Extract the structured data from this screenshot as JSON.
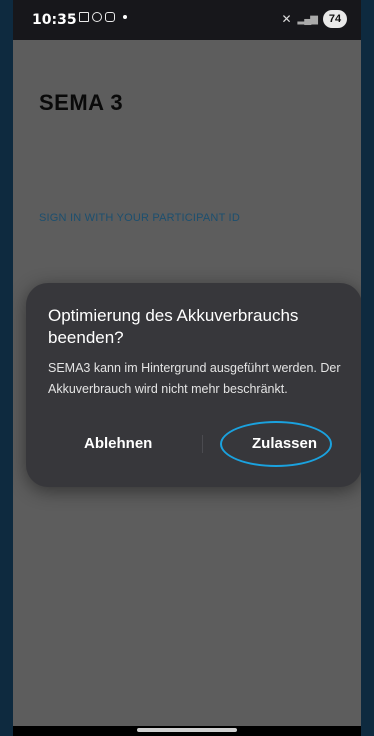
{
  "status_bar": {
    "time": "10:35",
    "battery": "74",
    "left_icons": [
      "screenshot-icon",
      "instagram-icon",
      "message-icon"
    ],
    "right_icons": [
      "mute-icon",
      "signal-icon"
    ]
  },
  "app": {
    "title": "SEMA 3",
    "sign_in_text": "SIGN IN WITH YOUR PARTICIPANT ID"
  },
  "dialog": {
    "title": "Optimierung des Akkuverbrauchs beenden?",
    "body": "SEMA3 kann im Hintergrund ausgeführt werden. Der Akkuverbrauch wird nicht mehr beschränkt.",
    "deny_label": "Ablehnen",
    "allow_label": "Zulassen",
    "highlight_color": "#1aa2df"
  }
}
